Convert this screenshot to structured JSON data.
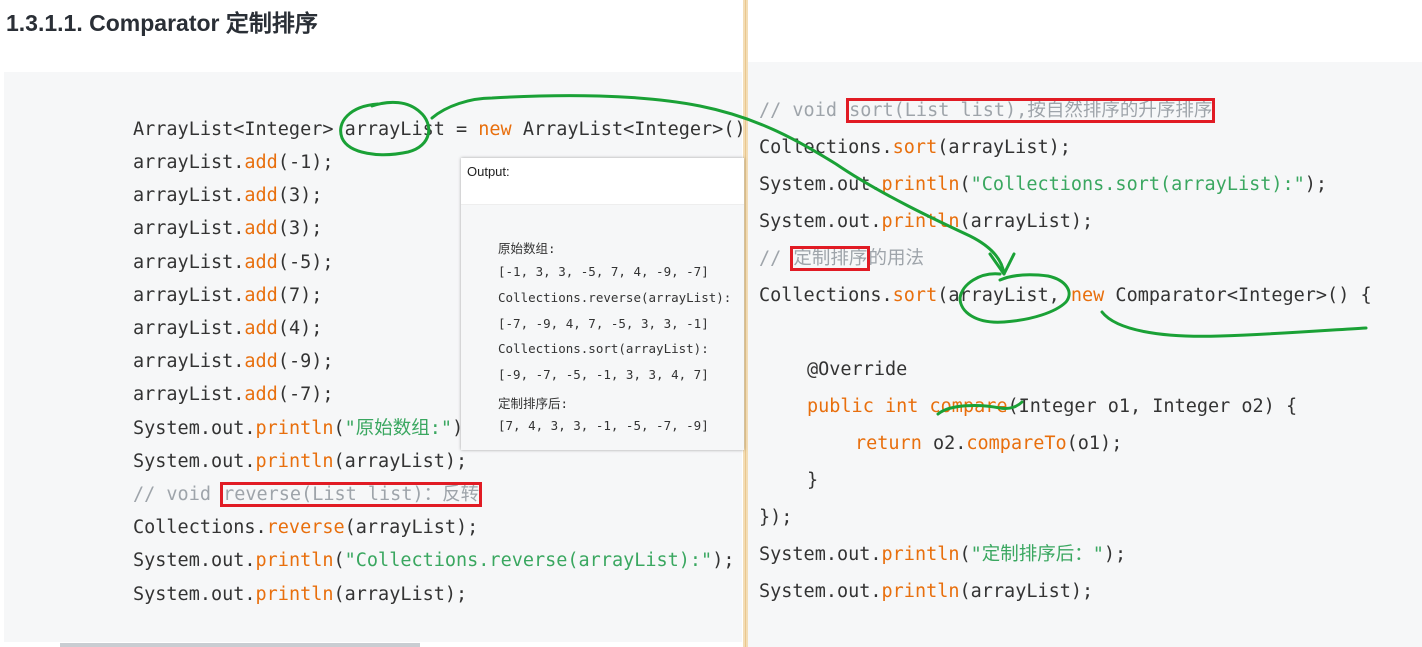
{
  "heading": {
    "number": "1.3.1.1.",
    "title": "Comparator 定制排序"
  },
  "left_code": {
    "l1_a": "ArrayList<Integer> arrayList = ",
    "l1_kw": "new",
    "l1_b": " ArrayList<Integer>();",
    "add_obj": "arrayList.",
    "add_fn": "add",
    "add_args": [
      "(-1);",
      "(3);",
      "(3);",
      "(-5);",
      "(7);",
      "(4);",
      "(-9);",
      "(-7);"
    ],
    "sysout": "System.out.",
    "println": "println",
    "s1_str": "\"原始数组:\"",
    "close": ");",
    "s2_args": "(arrayList);",
    "cm_prefix": "// void ",
    "cm_boxed": "reverse(List list)：反转",
    "coll": "Collections.",
    "reverse": "reverse",
    "reverse_args": "(arrayList);",
    "s3_str": "\"Collections.reverse(arrayList):\"",
    "open": "("
  },
  "output": {
    "title": "Output:",
    "lines": [
      "原始数组:",
      "[-1, 3, 3, -5, 7, 4, -9, -7]",
      "Collections.reverse(arrayList):",
      "[-7, -9, 4, 7, -5, 3, 3, -1]",
      "Collections.sort(arrayList):",
      "[-9, -7, -5, -1, 3, 3, 4, 7]",
      "定制排序后:",
      "[7, 4, 3, 3, -1, -5, -7, -9]"
    ]
  },
  "right_code": {
    "c1_prefix": "// void ",
    "c1_boxed": "sort(List list),按自然排序的升序排序",
    "coll": "Collections.",
    "sort": "sort",
    "args": "(arrayList);",
    "sysout": "System.out.",
    "println": "println",
    "r3_str": "\"Collections.sort(arrayList):\"",
    "close": ");",
    "c2_prefix": "// ",
    "c2_boxed": "定制排序",
    "c2_rest": "的用法",
    "r6_a": "(arrayList, ",
    "r6_kw": "new",
    "r6_b": " Comparator<Integer>() {",
    "override": "@Override",
    "public": "public",
    "int": "int",
    "compare": "compare",
    "compare_args": "(Integer o1, Integer o2) {",
    "return": "return",
    "o2": "o2.",
    "compareTo": "compareTo",
    "o1": "(o1);",
    "brace": "}",
    "end": "});",
    "r13_str": "\"定制排序后：\"",
    "open": "("
  },
  "colors": {
    "keyword": "#e86f0d",
    "string": "#3aa760",
    "comment": "#9ea4aa",
    "highlight": "#e11b24",
    "pen": "#1aa136"
  }
}
